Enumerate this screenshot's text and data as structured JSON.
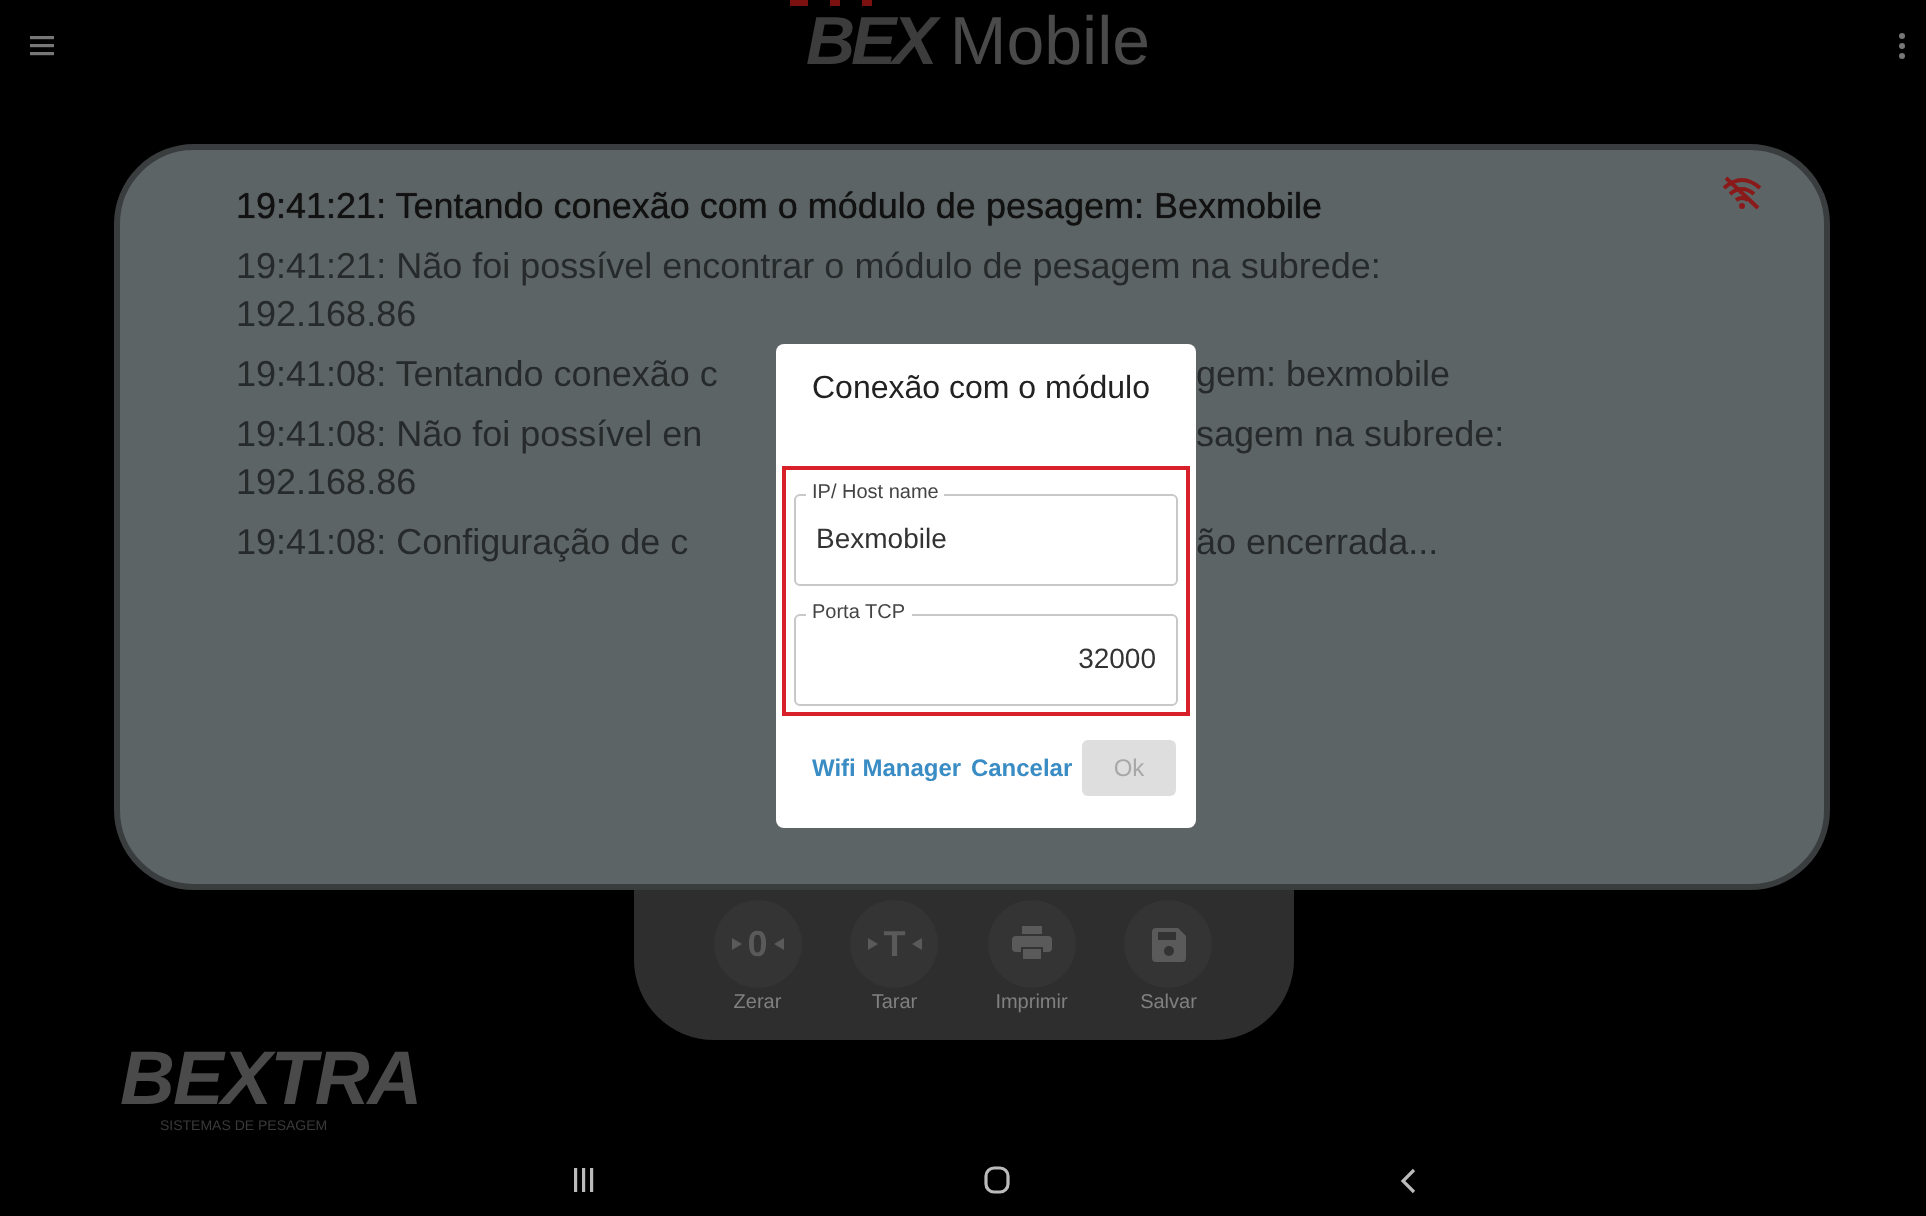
{
  "app_bar": {
    "logo_mark": "BEX",
    "logo_text": "Mobile"
  },
  "connection": {
    "connected": false
  },
  "log": [
    {
      "emphasis": true,
      "lines": [
        {
          "text": "19:41:21: Tentando conexão com o módulo de pesagem: Bexmobile"
        }
      ]
    },
    {
      "emphasis": false,
      "lines": [
        {
          "text": "19:41:21: Não foi possível encontrar o módulo de pesagem na subrede:"
        },
        {
          "text": "192.168.86"
        }
      ]
    },
    {
      "emphasis": false,
      "lines": [
        {
          "left": "19:41:08: Tentando conexão c",
          "right": "gem: bexmobile"
        }
      ]
    },
    {
      "emphasis": false,
      "lines": [
        {
          "left": "19:41:08: Não foi possível en",
          "right": "sagem na subrede:"
        },
        {
          "text": "192.168.86"
        }
      ]
    },
    {
      "emphasis": false,
      "lines": [
        {
          "left": "19:41:08: Configuração de c",
          "right": "ão encerrada..."
        }
      ]
    }
  ],
  "dialog": {
    "title": "Conexão com o módulo",
    "highlighted": true,
    "fields": [
      {
        "label": "IP/ Host name",
        "value": "Bexmobile",
        "kind": "text"
      },
      {
        "label": "Porta TCP",
        "value": "32000",
        "kind": "number"
      }
    ],
    "buttons": [
      {
        "label": "Wifi Manager",
        "disabled": false
      },
      {
        "label": "Cancelar",
        "disabled": false
      },
      {
        "label": "Ok",
        "disabled": true
      }
    ]
  },
  "actions": [
    {
      "kind": "zero",
      "glyph": "0",
      "label": "Zerar"
    },
    {
      "kind": "tare",
      "glyph": "T",
      "label": "Tarar"
    },
    {
      "kind": "print",
      "label": "Imprimir"
    },
    {
      "kind": "save",
      "label": "Salvar"
    }
  ],
  "brand": {
    "name": "BEXTRA",
    "tagline": "SISTEMAS DE PESAGEM"
  }
}
